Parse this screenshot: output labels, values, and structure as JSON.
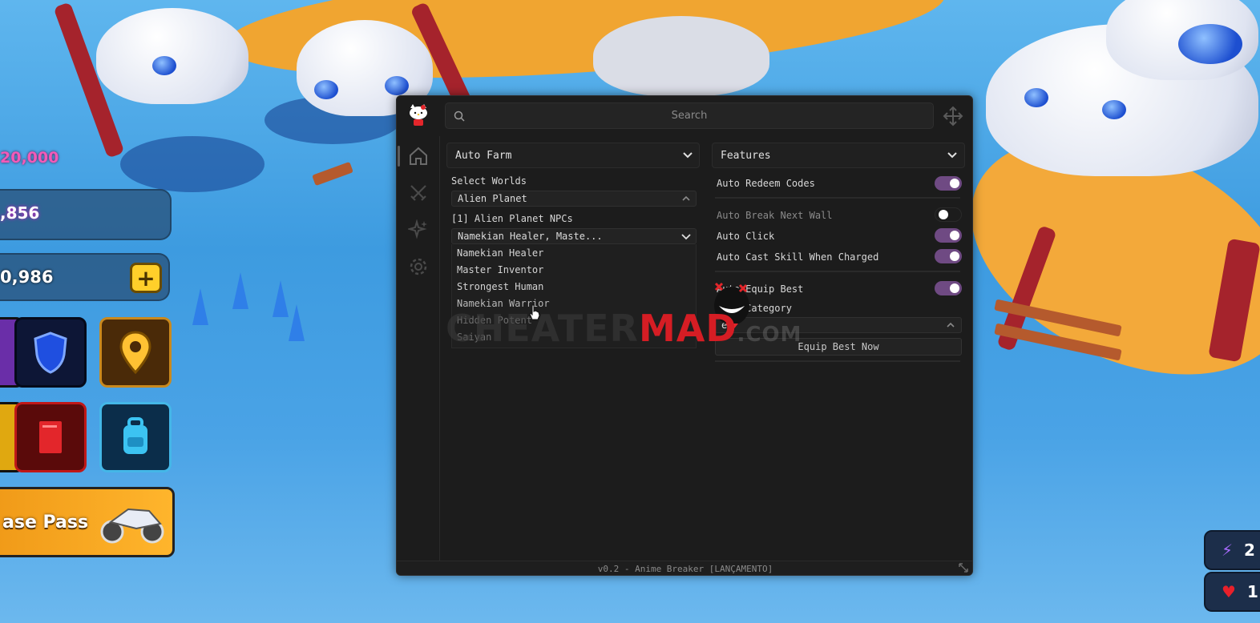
{
  "background_hud": {
    "stat_top": "20,000",
    "stat_mid": ",856",
    "stat_coins": "0,986",
    "plus_label": "+",
    "pass_label": "ase Pass",
    "rhud_top": "2",
    "rhud_bottom": "1"
  },
  "hub": {
    "search_placeholder": "Search",
    "footer": "v0.2 - Anime Breaker [LANÇAMENTO]",
    "sidebar_icons": [
      "home-icon",
      "swords-icon",
      "sparkle-icon",
      "gear-icon"
    ],
    "left_section": {
      "title": "Auto Farm",
      "select_worlds_label": "Select Worlds",
      "world_selected": "Alien Planet",
      "npc_label": "[1] Alien Planet NPCs",
      "npc_selected": "Namekian Healer, Maste...",
      "npc_options": [
        "Namekian Healer",
        "Master Inventor",
        "Strongest Human",
        "Namekian Warrior",
        "Hidden Potent",
        "Saiyan"
      ]
    },
    "right_section": {
      "title": "Features",
      "auto_redeem": "Auto Redeem Codes",
      "auto_break": "Auto Break Next Wall",
      "auto_click": "Auto Click",
      "auto_cast": "Auto Cast Skill When Charged",
      "auto_equip": "Auto Equip Best",
      "best_category": "Best Category",
      "best_category_value": "er",
      "equip_now": "Equip Best Now"
    }
  },
  "watermark": {
    "part1": "CHEATER",
    "part2": "MAD",
    "part3": ".COM"
  },
  "colors": {
    "toggle_on": "#6f4a83",
    "panel_bg": "#1c1c1c",
    "watermark_red": "#d51d24"
  }
}
